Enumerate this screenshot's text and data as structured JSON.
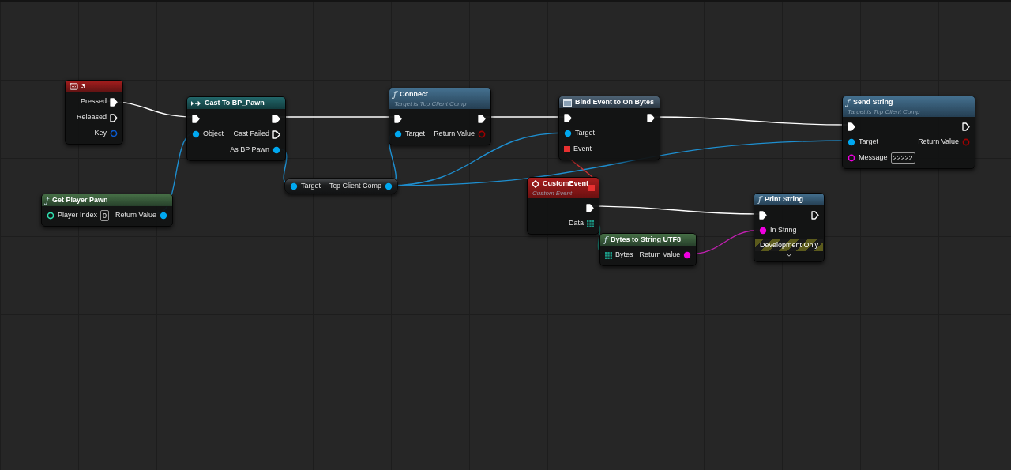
{
  "nodes": [
    {
      "kind": "key_event",
      "title": "3",
      "outputs": [
        {
          "kind": "exec",
          "label": "Pressed",
          "connected": true
        },
        {
          "kind": "exec",
          "label": "Released",
          "connected": false
        },
        {
          "kind": "struct",
          "label": "Key",
          "connected": false
        }
      ]
    },
    {
      "kind": "cast",
      "title": "Cast To BP_Pawn",
      "inputs": [
        {
          "kind": "exec",
          "connected": true
        },
        {
          "kind": "object",
          "label": "Object",
          "connected": true
        }
      ],
      "outputs": [
        {
          "kind": "exec",
          "connected": true
        },
        {
          "kind": "exec",
          "label": "Cast Failed",
          "connected": false
        },
        {
          "kind": "object",
          "label": "As BP Pawn",
          "connected": true
        }
      ]
    },
    {
      "kind": "pure",
      "glyph": "ƒ",
      "title": "Get Player Pawn",
      "inputs": [
        {
          "kind": "int",
          "label": "Player Index",
          "connected": false,
          "value": "0"
        }
      ],
      "outputs": [
        {
          "kind": "object",
          "label": "Return Value",
          "connected": true
        }
      ]
    },
    {
      "kind": "variable",
      "inputs": [
        {
          "kind": "object",
          "label": "Target",
          "connected": true
        }
      ],
      "outputs": [
        {
          "kind": "object",
          "label": "Tcp Client Comp",
          "connected": true
        }
      ]
    },
    {
      "kind": "function",
      "glyph": "ƒ",
      "title": "Connect",
      "subtitle": "Target is Tcp Client Comp",
      "inputs": [
        {
          "kind": "exec",
          "connected": true
        },
        {
          "kind": "object",
          "label": "Target",
          "connected": true
        }
      ],
      "outputs": [
        {
          "kind": "exec",
          "connected": true
        },
        {
          "kind": "bool",
          "label": "Return Value",
          "connected": false
        }
      ]
    },
    {
      "kind": "bind",
      "title": "Bind Event to On Bytes",
      "inputs": [
        {
          "kind": "exec",
          "connected": true
        },
        {
          "kind": "object",
          "label": "Target",
          "connected": true
        },
        {
          "kind": "delegate",
          "label": "Event",
          "connected": true
        }
      ],
      "outputs": [
        {
          "kind": "exec",
          "connected": true
        }
      ]
    },
    {
      "kind": "function",
      "glyph": "ƒ",
      "title": "Send String",
      "subtitle": "Target is Tcp Client Comp",
      "inputs": [
        {
          "kind": "exec",
          "connected": true
        },
        {
          "kind": "object",
          "label": "Target",
          "connected": true
        },
        {
          "kind": "string",
          "label": "Message",
          "connected": false,
          "value": "22222"
        }
      ],
      "outputs": [
        {
          "kind": "exec",
          "connected": false
        },
        {
          "kind": "bool",
          "label": "Return Value",
          "connected": false
        }
      ]
    },
    {
      "kind": "custom_event",
      "title": "CustomEvent",
      "subtitle": "Custom Event",
      "header_pin": {
        "kind": "delegate",
        "connected": true
      },
      "outputs": [
        {
          "kind": "exec",
          "connected": true
        },
        {
          "kind": "bytes",
          "label": "Data",
          "connected": true
        }
      ]
    },
    {
      "kind": "pure",
      "glyph": "ƒ",
      "title": "Bytes to String UTF8",
      "inputs": [
        {
          "kind": "bytes",
          "label": "Bytes",
          "connected": true
        }
      ],
      "outputs": [
        {
          "kind": "string",
          "label": "Return Value",
          "connected": true
        }
      ]
    },
    {
      "kind": "function",
      "glyph": "ƒ",
      "title": "Print String",
      "development_only": "Development Only",
      "inputs": [
        {
          "kind": "exec",
          "connected": true
        },
        {
          "kind": "string",
          "label": "In String",
          "connected": true
        }
      ],
      "outputs": [
        {
          "kind": "exec",
          "connected": false
        }
      ]
    }
  ]
}
